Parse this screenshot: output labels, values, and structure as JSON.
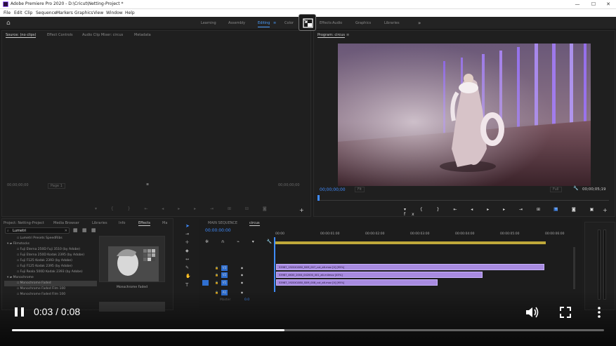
{
  "window": {
    "title": "Adobe Premiere Pro 2020 - D:\\Cricut\\Netting-Project *",
    "buttons": [
      "—",
      "☐",
      "✕"
    ]
  },
  "menu": [
    "File",
    "Edit",
    "Clip",
    "Sequence",
    "Markers",
    "Graphics",
    "View",
    "Window",
    "Help"
  ],
  "workspaces": {
    "items": [
      "Learning",
      "Assembly",
      "Editing",
      "Color",
      "Effects",
      "Audio",
      "Graphics",
      "Libraries"
    ],
    "active": "Editing",
    "more": "»"
  },
  "source_panel": {
    "tabs": [
      "Source: (no clips)",
      "Effect Controls",
      "Audio Clip Mixer: circus",
      "Metadata"
    ],
    "timecode_left": "00;00;00;00",
    "page": "Page 1",
    "timecode_right": "00;00;00;00"
  },
  "program_panel": {
    "tab": "Program: circus",
    "timecode_left": "00;00;00;00",
    "fit": "Fit",
    "quality": "Full",
    "timecode_right": "00;00;05;19"
  },
  "project_panel": {
    "tabs": [
      "Project: Netting-Project",
      "Media Browser",
      "Libraries",
      "Info",
      "Effects",
      "Ma"
    ],
    "search_value": "Lumetri",
    "tree": [
      {
        "label": "Lumetri Presets SpeedRibs",
        "depth": 2,
        "sel": false
      },
      {
        "label": "Filmstocks",
        "depth": 1,
        "sel": false
      },
      {
        "label": "Fuji Eterna 250D Fuji 3510 (by Adobe)",
        "depth": 2,
        "sel": false
      },
      {
        "label": "Fuji Eterna 250D Kodak 2395 (by Adobe)",
        "depth": 2,
        "sel": false
      },
      {
        "label": "Fuji F125 Kodak 2393 (by Adobe)",
        "depth": 2,
        "sel": false
      },
      {
        "label": "Fuji F125 Kodak 2395 (by Adobe)",
        "depth": 2,
        "sel": false
      },
      {
        "label": "Fuji Reala 500D Kodak 2393 (by Adobe)",
        "depth": 2,
        "sel": false
      },
      {
        "label": "Monochrome",
        "depth": 1,
        "sel": false
      },
      {
        "label": "Monochrome Faded",
        "depth": 2,
        "sel": true
      },
      {
        "label": "Monochrome Faded Film 100",
        "depth": 2,
        "sel": false
      },
      {
        "label": "Monochrome Faded Film 100",
        "depth": 2,
        "sel": false
      }
    ],
    "thumb_caption": "Monochrome Faded"
  },
  "timeline": {
    "tabs": [
      "MAIN SEQUENCE",
      "circus"
    ],
    "timecode": "00:00:00:00",
    "ruler": [
      "00:00",
      "00:00:01:00",
      "00:00:02:00",
      "00:00:03:00",
      "00:00:04:00",
      "00:00:05:00",
      "00:00:06:00"
    ],
    "tracks": [
      "V3",
      "V2",
      "V1",
      "A1"
    ],
    "master_label": "Master",
    "master_value": "0.0",
    "clips": [
      {
        "label": "53987_1920X1080_S0M_007_cut_alt.mov [V] [95%]",
        "end": 0.78
      },
      {
        "label": "53987_4K00_2004_042000_001_alt.m4mov [45%]",
        "end": 0.6
      },
      {
        "label": "53987_1920X1080_S0M_008_cut_alt.mov [V] [95%]",
        "end": 0.47
      }
    ]
  },
  "player": {
    "time": "0:03 / 0:08",
    "progress": 0.46
  }
}
